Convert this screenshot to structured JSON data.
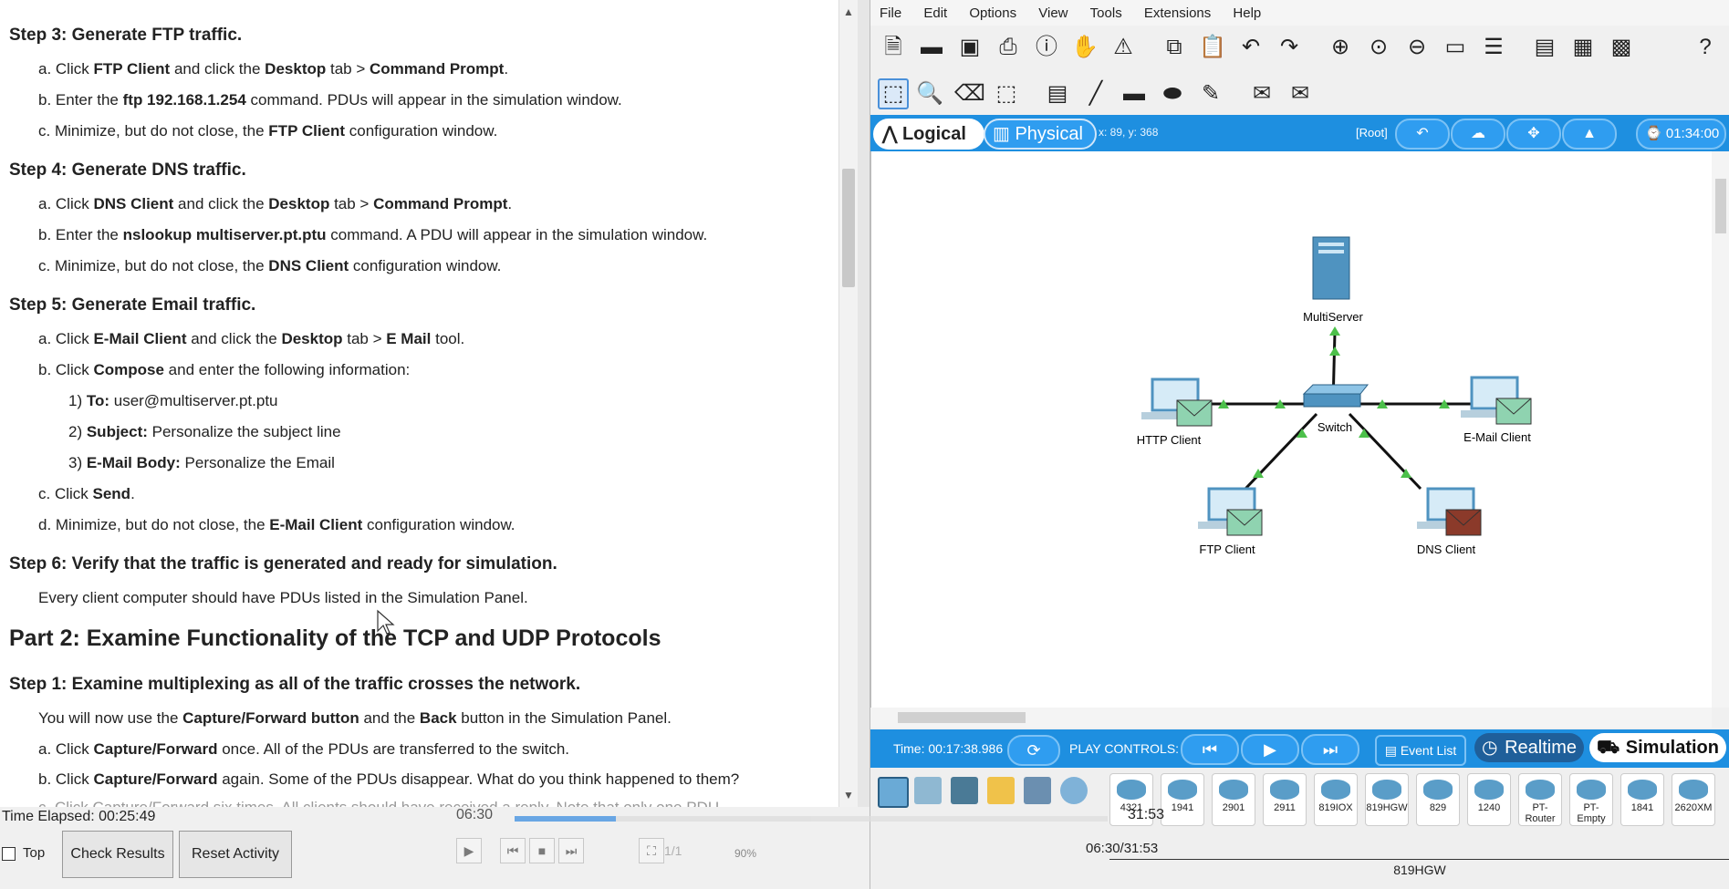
{
  "doc": {
    "step3_title": "Step 3:  Generate FTP traffic.",
    "step3_a": [
      "a.  Click ",
      "FTP Client",
      " and click the ",
      "Desktop",
      " tab > ",
      "Command Prompt",
      "."
    ],
    "step3_b": [
      "b.  Enter the ",
      "ftp 192.168.1.254",
      " command. PDUs will appear in the simulation window."
    ],
    "step3_c": [
      "c.  Minimize, but do not close, the ",
      "FTP Client",
      " configuration window."
    ],
    "step4_title": "Step 4:  Generate DNS traffic.",
    "step4_a": [
      "a.  Click ",
      "DNS Client",
      " and click the ",
      "Desktop",
      " tab > ",
      "Command Prompt",
      "."
    ],
    "step4_b": [
      "b.  Enter the ",
      "nslookup multiserver.pt.ptu",
      " command. A PDU will appear in the simulation window."
    ],
    "step4_c": [
      "c.  Minimize, but do not close, the ",
      "DNS Client",
      " configuration window."
    ],
    "step5_title": "Step 5:  Generate Email traffic.",
    "step5_a": [
      "a.  Click ",
      "E-Mail Client",
      " and click the ",
      "Desktop",
      " tab > ",
      "E Mail",
      " tool."
    ],
    "step5_b": [
      "b.  Click ",
      "Compose",
      " and enter the following information:"
    ],
    "step5_b1": [
      "1)  ",
      "To:",
      " user@multiserver.pt.ptu"
    ],
    "step5_b2": [
      "2)  ",
      "Subject:",
      " Personalize the subject line"
    ],
    "step5_b3": [
      "3)  ",
      "E-Mail Body:",
      " Personalize the Email"
    ],
    "step5_c": [
      "c.  Click ",
      "Send",
      "."
    ],
    "step5_d": [
      "d.  Minimize, but do not close, the ",
      "E-Mail Client",
      " configuration window."
    ],
    "step6_title": "Step 6:  Verify that the traffic is generated and ready for simulation.",
    "step6_text": "Every client computer should have PDUs listed in the Simulation Panel.",
    "part2_title": "Part 2:  Examine Functionality of the TCP and UDP Protocols",
    "p2s1_title": "Step 1:  Examine multiplexing as all of the traffic crosses the network.",
    "p2s1_text": [
      "You will now use the ",
      "Capture/Forward button",
      " and the ",
      "Back",
      " button in the Simulation Panel."
    ],
    "p2s1_a": [
      "a.  Click ",
      "Capture/Forward",
      " once. All of the PDUs are transferred to the switch."
    ],
    "p2s1_b": [
      "b.  Click ",
      "Capture/Forward",
      " again. Some of the PDUs disappear. What do you think happened to them?"
    ],
    "p2s1_c_partial": "c.  Click Capture/Forward six times. All clients should have received a reply. Note that only one PDU"
  },
  "menu": [
    "File",
    "Edit",
    "Options",
    "View",
    "Tools",
    "Extensions",
    "Help"
  ],
  "toolbar1_icons": [
    "new-file-icon",
    "open-folder-icon",
    "save-icon",
    "print-icon",
    "info-icon",
    "wizard-icon",
    "network-info-icon",
    "copy-icon",
    "paste-icon",
    "undo-icon",
    "redo-icon",
    "zoom-in-icon",
    "zoom-reset-icon",
    "zoom-out-icon",
    "drawing-palette-icon",
    "custom-devices-icon",
    "pdu-list-icon",
    "viewport-icon",
    "screenshot-icon",
    "help-icon"
  ],
  "toolbar2_icons": [
    "select-icon",
    "inspect-icon",
    "delete-icon",
    "resize-icon",
    "note-icon",
    "line-draw-icon",
    "rectangle-icon",
    "ellipse-icon",
    "freeform-icon",
    "add-simple-pdu-icon",
    "add-complex-pdu-icon"
  ],
  "view": {
    "logical": "Logical",
    "physical": "Physical",
    "coords": "x: 89, y: 368",
    "root": "[Root]",
    "clock": "01:34:00"
  },
  "topology": {
    "server": "MultiServer",
    "switch": "Switch",
    "http": "HTTP Client",
    "email": "E-Mail Client",
    "ftp": "FTP Client",
    "dns": "DNS Client"
  },
  "sim": {
    "time": "Time: 00:17:38.986",
    "play_controls": "PLAY CONTROLS:",
    "event_list": "Event List",
    "realtime": "Realtime",
    "simulation": "Simulation"
  },
  "devices": [
    "4321",
    "1941",
    "2901",
    "2911",
    "819IOX",
    "819HGW",
    "829",
    "1240",
    "PT-Router",
    "PT-Empty",
    "1841",
    "2620XM"
  ],
  "device_name": "819HGW",
  "bottom": {
    "elapsed": "Time Elapsed: 00:25:49",
    "top": "Top",
    "check": "Check Results",
    "reset": "Reset Activity",
    "t_current": "06:30",
    "t_total": "31:53",
    "page": "1/1",
    "zoom": "90%",
    "t_combined": "06:30/31:53",
    "progress": 0.17
  },
  "colors": {
    "accent": "#1e8fe0",
    "envelope_green": "#8fd3b0",
    "envelope_red": "#8b3a2a",
    "link": "#111111",
    "link_light": "#4cc04a"
  }
}
